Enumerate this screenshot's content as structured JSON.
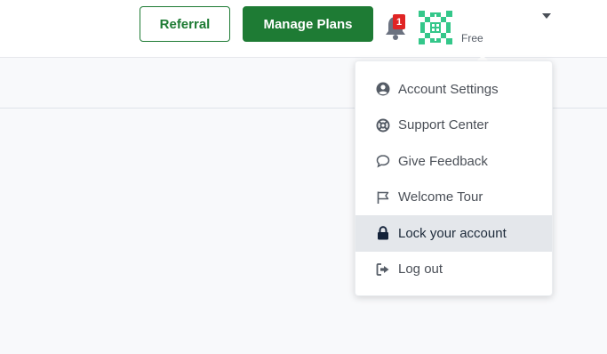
{
  "header": {
    "referral_label": "Referral",
    "manage_plans_label": "Manage Plans",
    "notification_count": "1",
    "plan_label": "Free"
  },
  "menu": {
    "items": [
      {
        "label": "Account Settings",
        "icon": "user-circle-icon"
      },
      {
        "label": "Support Center",
        "icon": "life-ring-icon"
      },
      {
        "label": "Give Feedback",
        "icon": "speech-bubble-icon"
      },
      {
        "label": "Welcome Tour",
        "icon": "flag-icon"
      },
      {
        "label": "Lock your account",
        "icon": "lock-icon",
        "active": true
      },
      {
        "label": "Log out",
        "icon": "sign-out-icon"
      }
    ]
  },
  "colors": {
    "brand_green": "#1e7b34",
    "badge_red": "#e02424",
    "avatar_green": "#34c78a",
    "active_item_bg": "#e4e7eb"
  }
}
